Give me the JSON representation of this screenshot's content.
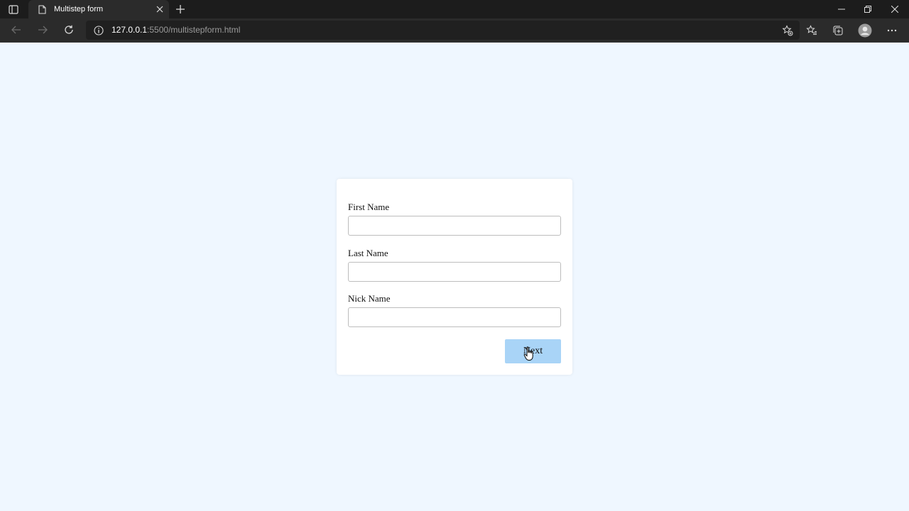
{
  "browser": {
    "tab_title": "Multistep form",
    "url_host": "127.0.0.1",
    "url_rest": ":5500/multistepform.html"
  },
  "icons": {
    "tab_actions": "tab-actions-icon",
    "page": "page-icon",
    "close_tab": "close-icon",
    "new_tab": "plus-icon",
    "minimize": "minimize-icon",
    "restore": "restore-icon",
    "close_window": "close-icon",
    "back": "back-arrow-icon",
    "forward": "forward-arrow-icon",
    "refresh": "refresh-icon",
    "site_info": "info-icon",
    "add_favorite": "add-favorite-icon",
    "favorites": "favorites-icon",
    "collections": "collections-icon",
    "profile": "profile-icon",
    "more": "more-icon",
    "cursor": "hand-pointer-icon"
  },
  "form": {
    "fields": [
      {
        "label": "First Name",
        "value": "",
        "placeholder": ""
      },
      {
        "label": "Last Name",
        "value": "",
        "placeholder": ""
      },
      {
        "label": "Nick Name",
        "value": "",
        "placeholder": ""
      }
    ],
    "next_label": "Next"
  },
  "colors": {
    "page_background": "#eff7ff",
    "card_background": "#ffffff",
    "button_background": "#a9d4f7",
    "titlebar": "#1c1c1c",
    "toolbar": "#2b2b2b"
  }
}
